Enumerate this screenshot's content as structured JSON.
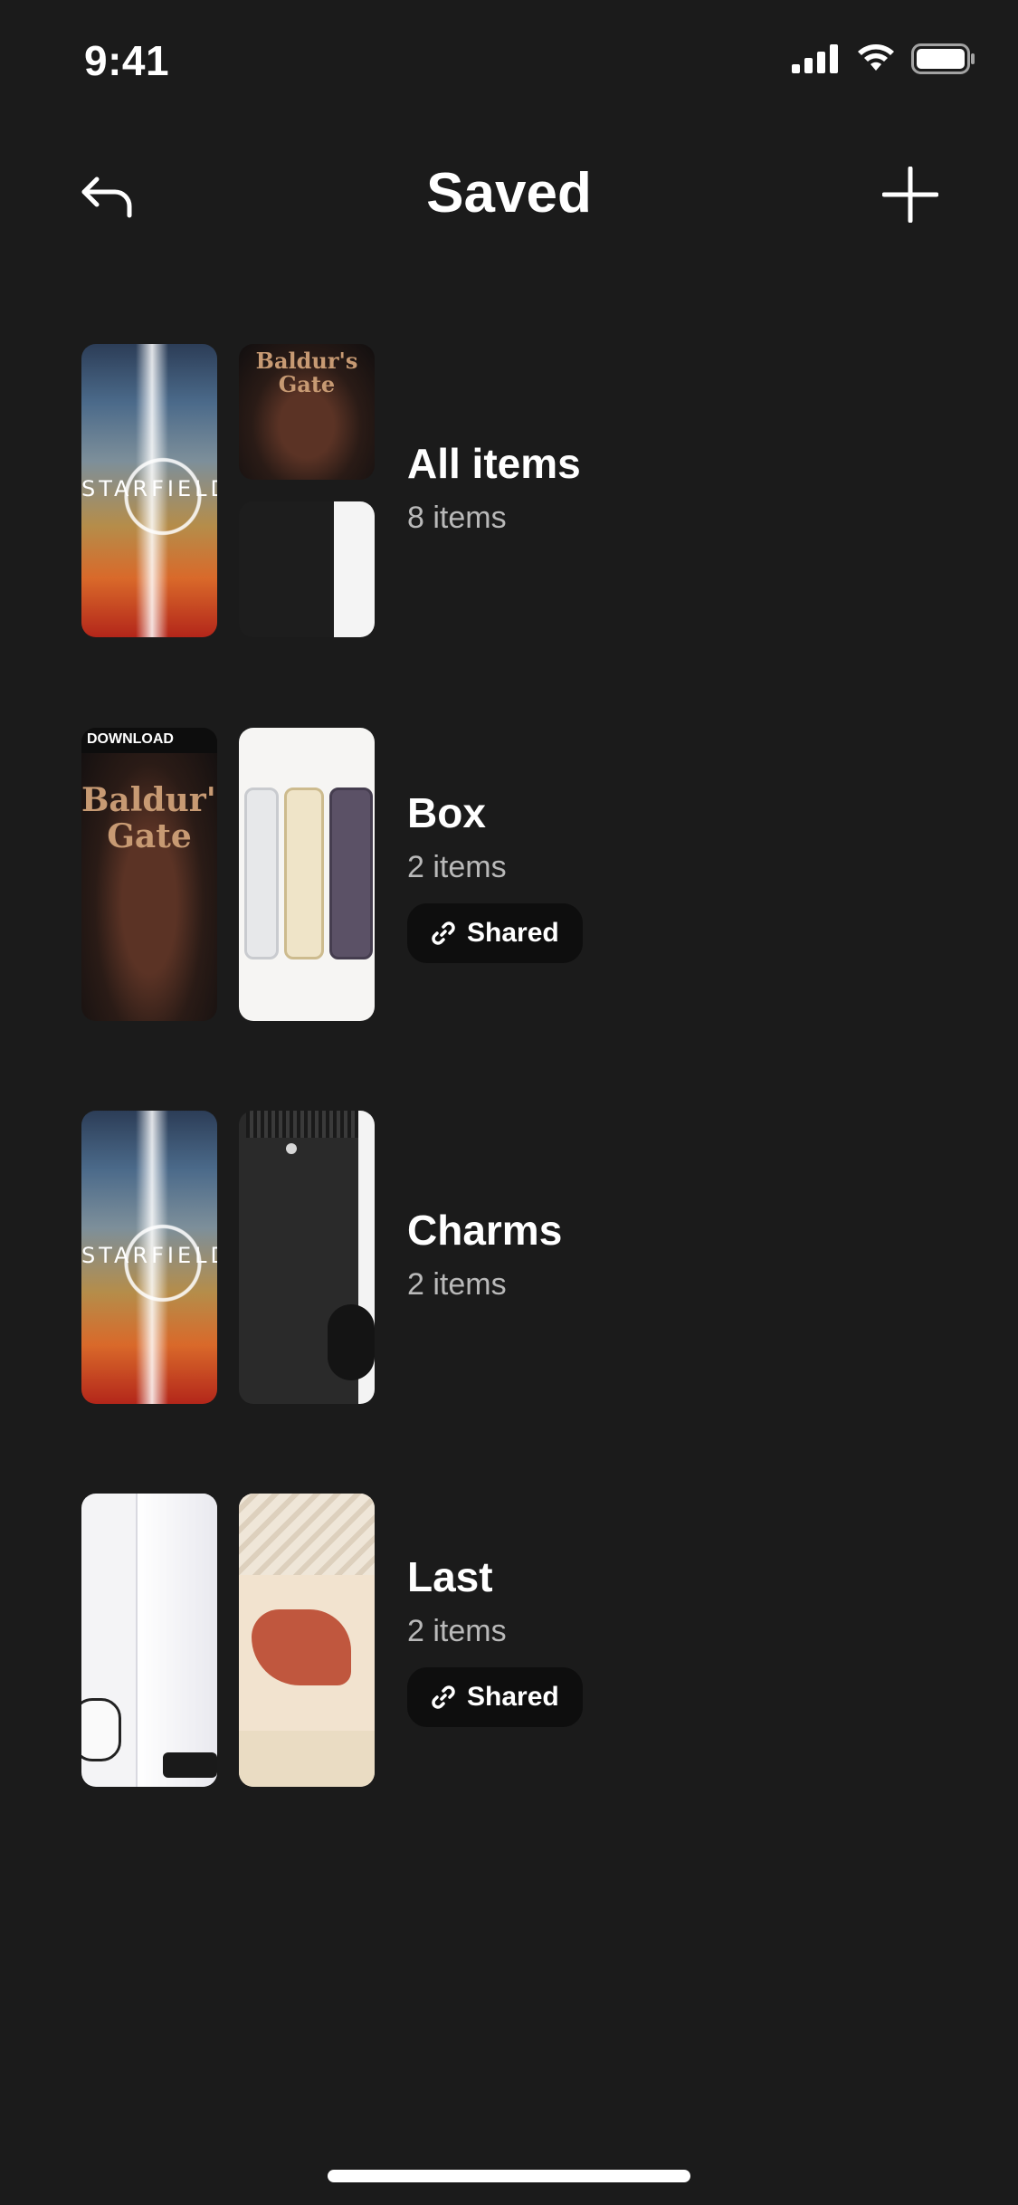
{
  "status_bar": {
    "time": "9:41",
    "icons": [
      "signal-icon",
      "wifi-icon",
      "battery-icon"
    ]
  },
  "header": {
    "title": "Saved",
    "back_icon": "back-arrow-icon",
    "add_icon": "plus-icon"
  },
  "collections": [
    {
      "name": "All items",
      "count": "8 items",
      "shared": false,
      "thumbnails": [
        "starfield-cover",
        "baldurs-gate-cover",
        "xbox-console"
      ]
    },
    {
      "name": "Box",
      "count": "2 items",
      "shared": true,
      "shared_label": "Shared",
      "thumbnails": [
        "baldurs-gate-cover",
        "iphone-lineup"
      ]
    },
    {
      "name": "Charms",
      "count": "2 items",
      "shared": false,
      "thumbnails": [
        "starfield-cover",
        "xbox-console"
      ]
    },
    {
      "name": "Last",
      "count": "2 items",
      "shared": true,
      "shared_label": "Shared",
      "thumbnails": [
        "ps5-console",
        "sneaker"
      ]
    }
  ],
  "artwork_text": {
    "starfield": "STARFIELD",
    "baldurs_gate": "Baldur's Gate",
    "download_banner": "DOWNLOAD"
  },
  "colors": {
    "background": "#1b1b1b",
    "text_primary": "#ffffff",
    "text_secondary": "#b9b9b9",
    "badge_background": "#0e0e0e"
  }
}
